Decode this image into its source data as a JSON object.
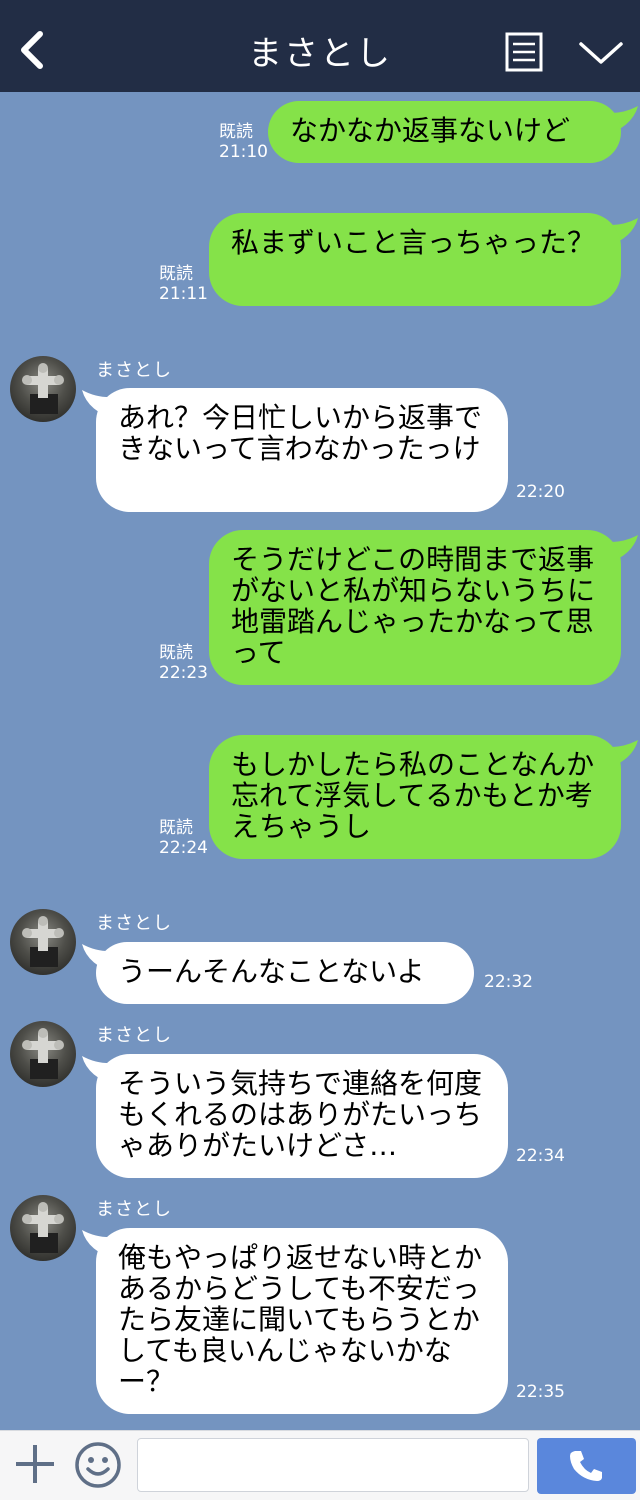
{
  "header": {
    "title": "まさとし",
    "back_icon": "chevron-left-icon",
    "menu_icon": "document-list-icon",
    "toggle_icon": "chevron-down-icon",
    "background": "#222d45"
  },
  "theme": {
    "chat_background": "#7494c0",
    "sent_bubble": "#85e249",
    "received_bubble": "#ffffff"
  },
  "messages": [
    {
      "from": "me",
      "text": "なかなか返事ないけど",
      "read_label": "既読",
      "time": "21:10"
    },
    {
      "from": "me",
      "text": "私まずいこと言っちゃった？",
      "read_label": "既読",
      "time": "21:11"
    },
    {
      "from": "them",
      "sender": "まさとし",
      "text": "あれ？今日忙しいから返事できないって言わなかったっけ",
      "time": "22:20"
    },
    {
      "from": "me",
      "text": "そうだけどこの時間まで返事がないと私が知らないうちに地雷踏んじゃったかなって思って",
      "read_label": "既読",
      "time": "22:23"
    },
    {
      "from": "me",
      "text": "もしかしたら私のことなんか忘れて浮気してるかもとか考えちゃうし",
      "read_label": "既読",
      "time": "22:24"
    },
    {
      "from": "them",
      "sender": "まさとし",
      "text": "うーんそんなことないよ",
      "time": "22:32"
    },
    {
      "from": "them",
      "sender": "まさとし",
      "text": "そういう気持ちで連絡を何度もくれるのはありがたいっちゃありがたいけどさ…",
      "time": "22:34"
    },
    {
      "from": "them",
      "sender": "まさとし",
      "text": "俺もやっぱり返せない時とかあるからどうしても不安だったら友達に聞いてもらうとかしても良いんじゃないかなー？",
      "time": "22:35"
    }
  ],
  "footer": {
    "add_icon": "plus-icon",
    "emoji_icon": "smiley-icon",
    "input_value": "",
    "call_icon": "phone-icon"
  }
}
